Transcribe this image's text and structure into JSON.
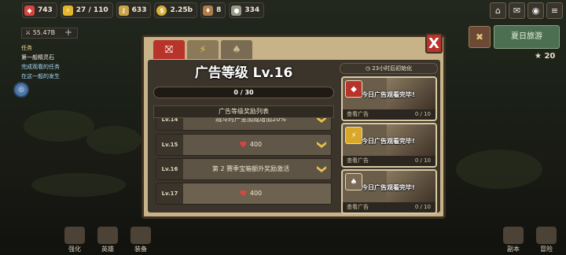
{
  "resources": [
    {
      "icon": "gem-icon",
      "value": "743",
      "color": "#d8453f"
    },
    {
      "icon": "lightning-icon",
      "value": "27 / 110",
      "color": "#e3b52a"
    },
    {
      "icon": "key-icon",
      "value": "633",
      "color": "#c9a34a"
    },
    {
      "icon": "coin-icon",
      "value": "2.25b",
      "color": "#d9b13a"
    },
    {
      "icon": "token-icon",
      "value": "8",
      "color": "#b07d4a"
    },
    {
      "icon": "ore-icon",
      "value": "334",
      "color": "#9a9a88"
    }
  ],
  "left_panel": {
    "power": "⚔ 55.47B",
    "plus": "+",
    "task_header": "任务",
    "task_items": [
      "第一般精灵石",
      "完成观看的任务",
      "在这一般的发生"
    ]
  },
  "right_side": {
    "event_title": "夏日旅游",
    "star_count": "20"
  },
  "modal": {
    "close_glyph": "X",
    "level_title": "广告等级 Lv.16",
    "progress_text": "0 / 30",
    "progress_value": 0,
    "progress_max": 30,
    "reward_list_title": "广告等级奖励列表",
    "rewards": [
      {
        "level": "Lv.14",
        "desc": "战斗时产金加成增加20%",
        "partial": true
      },
      {
        "level": "Lv.15",
        "desc": "400",
        "gem": true
      },
      {
        "level": "Lv.16",
        "desc": "第 2 赛季宝箱额外奖励激活"
      },
      {
        "level": "Lv.17",
        "desc": "400",
        "gem": true
      }
    ],
    "reset_text": "23小时后初始化",
    "ad_cards": [
      {
        "status": "今日广告观看完毕!",
        "label": "查看广告",
        "count": "0 / 10"
      },
      {
        "status": "今日广告观看完毕!",
        "label": "查看广告",
        "count": "0 / 10"
      },
      {
        "status": "今日广告观看完毕!",
        "label": "查看广告",
        "count": "0 / 10"
      }
    ]
  },
  "bottom_nav": [
    "强化",
    "英雄",
    "装备",
    "副本",
    "冒险"
  ]
}
